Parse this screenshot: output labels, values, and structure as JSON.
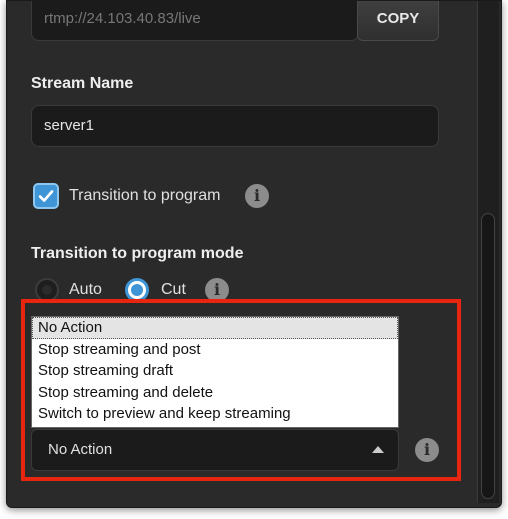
{
  "stream": {
    "url_value": "rtmp://24.103.40.83/live",
    "copy_label": "COPY",
    "name_label": "Stream Name",
    "name_value": "server1"
  },
  "transition": {
    "checkbox_label": "Transition to program",
    "checked": true,
    "mode_label": "Transition to program mode",
    "mode_options": [
      {
        "label": "Auto",
        "selected": false
      },
      {
        "label": "Cut",
        "selected": true
      }
    ]
  },
  "end_action": {
    "options": [
      "No Action",
      "Stop streaming and post",
      "Stop streaming draft",
      "Stop streaming and delete",
      "Switch to preview and keep streaming"
    ],
    "selected_value": "No Action"
  },
  "colors": {
    "panel_bg": "#2a2a2a",
    "accent_blue": "#3f95d6",
    "highlight_red": "#e8250e"
  },
  "icons": {
    "info": "i"
  }
}
